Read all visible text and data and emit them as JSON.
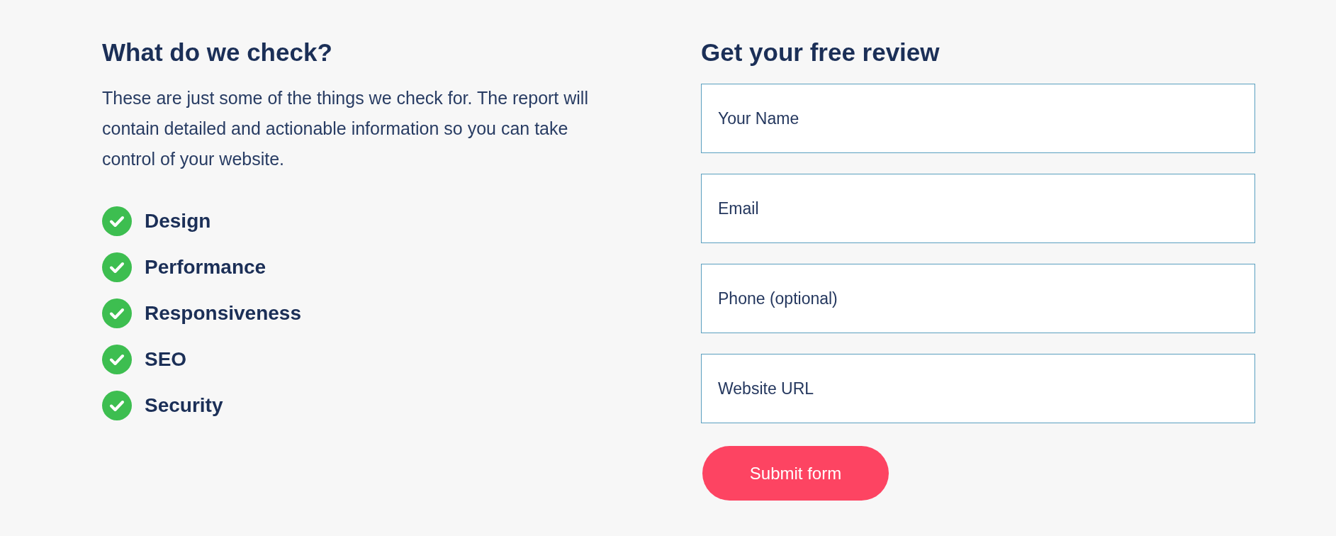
{
  "checklist": {
    "title": "What do we check?",
    "description": "These are just some of the things we check for. The report will contain detailed and actionable information so you can take control of your website.",
    "items": [
      {
        "label": "Design"
      },
      {
        "label": "Performance"
      },
      {
        "label": "Responsiveness"
      },
      {
        "label": "SEO"
      },
      {
        "label": "Security"
      }
    ]
  },
  "form": {
    "title": "Get your free review",
    "fields": [
      {
        "placeholder": "Your Name"
      },
      {
        "placeholder": "Email"
      },
      {
        "placeholder": "Phone (optional)"
      },
      {
        "placeholder": "Website URL"
      }
    ],
    "submit_button": "Submit form"
  }
}
